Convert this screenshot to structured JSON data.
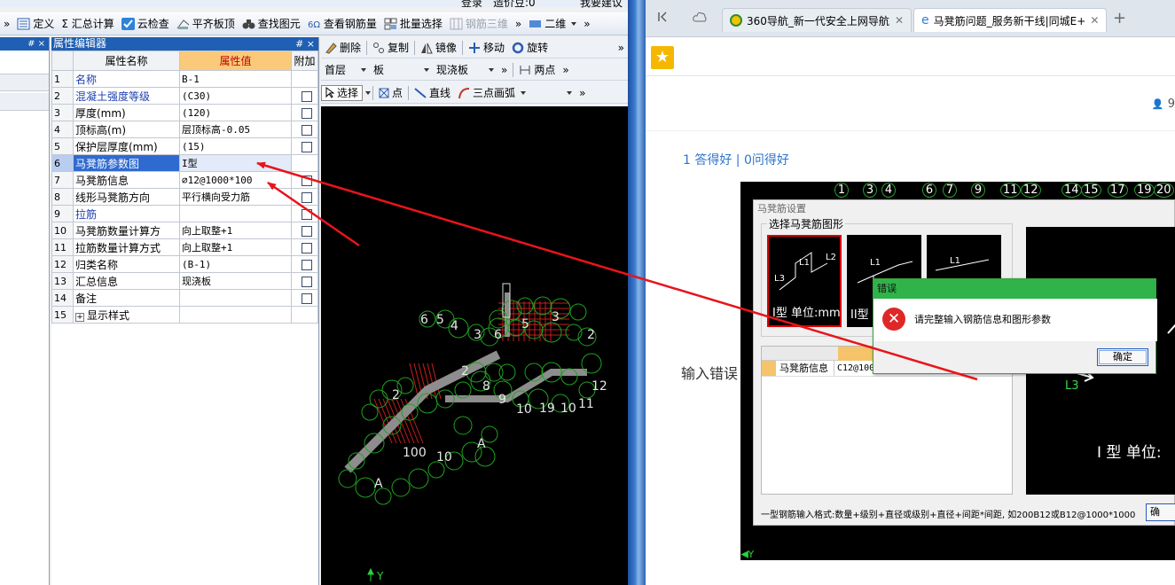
{
  "cad": {
    "top_strip": [
      "登录",
      "造价豆:0",
      "我要建议"
    ],
    "toolbar": [
      {
        "label": "»",
        "icon": ""
      },
      {
        "label": "定义",
        "icon": "define-icon"
      },
      {
        "label": "Σ 汇总计算",
        "icon": ""
      },
      {
        "label": "云检查",
        "icon": "cloud-check-icon"
      },
      {
        "label": "平齐板顶",
        "icon": "align-icon"
      },
      {
        "label": "查找图元",
        "icon": "binoculars-icon"
      },
      {
        "label": "查看钢筋量",
        "icon": "rebar-icon"
      },
      {
        "label": "批量选择",
        "icon": "batch-icon"
      },
      {
        "label": "钢筋三维",
        "icon": "rebar-3d-icon",
        "disabled": true
      },
      {
        "label": "»",
        "icon": ""
      },
      {
        "label": "二维",
        "icon": "2d-icon",
        "dropdown": true
      },
      {
        "label": "»",
        "icon": ""
      }
    ],
    "left_pane_pin": "# ×",
    "property_editor": {
      "title": "属性编辑器",
      "pin": "# ×",
      "headers": {
        "name": "属性名称",
        "value": "属性值",
        "extra": "附加"
      },
      "rows": [
        {
          "n": "1",
          "name": "名称",
          "value": "B-1",
          "blue": true,
          "check": false
        },
        {
          "n": "2",
          "name": "混凝土强度等级",
          "value": "(C30)",
          "blue": true,
          "check": true
        },
        {
          "n": "3",
          "name": "厚度(mm)",
          "value": "(120)",
          "blue": false,
          "check": true
        },
        {
          "n": "4",
          "name": "顶标高(m)",
          "value": "层顶标高-0.05",
          "blue": false,
          "check": true
        },
        {
          "n": "5",
          "name": "保护层厚度(mm)",
          "value": "(15)",
          "blue": false,
          "check": true
        },
        {
          "n": "6",
          "name": "马凳筋参数图",
          "value": "I型",
          "blue": false,
          "check": false,
          "selected": true
        },
        {
          "n": "7",
          "name": "马凳筋信息",
          "value": "⌀12@1000*100",
          "blue": false,
          "check": true
        },
        {
          "n": "8",
          "name": "线形马凳筋方向",
          "value": "平行横向受力筋",
          "blue": false,
          "check": true
        },
        {
          "n": "9",
          "name": "拉筋",
          "value": "",
          "blue": true,
          "check": true
        },
        {
          "n": "10",
          "name": "马凳筋数量计算方",
          "value": "向上取整+1",
          "blue": false,
          "check": true
        },
        {
          "n": "11",
          "name": "拉筋数量计算方式",
          "value": "向上取整+1",
          "blue": false,
          "check": true
        },
        {
          "n": "12",
          "name": "归类名称",
          "value": "(B-1)",
          "blue": false,
          "check": true
        },
        {
          "n": "13",
          "name": "汇总信息",
          "value": "现浇板",
          "blue": false,
          "check": true
        },
        {
          "n": "14",
          "name": "备注",
          "value": "",
          "blue": false,
          "check": true
        },
        {
          "n": "15",
          "name": "显示样式",
          "value": "",
          "blue": false,
          "check": false,
          "expand": true
        }
      ]
    },
    "draw_toolbar": {
      "row1": [
        "删除",
        "复制",
        "镜像",
        "移动",
        "旋转",
        "»"
      ],
      "row2": {
        "floor": "首层",
        "type": "板",
        "sub": "现浇板",
        "more": "»",
        "two_point": "两点",
        "more2": "»"
      },
      "row3": [
        "选择",
        "点",
        "直线",
        "三点画弧",
        "»"
      ]
    },
    "axis_label": "Y"
  },
  "browser": {
    "tabs": [
      {
        "label": "360导航_新一代安全上网导航",
        "active": false
      },
      {
        "label": "马凳筋问题_服务新干线|同城E+",
        "active": true
      }
    ],
    "new_tab": "+",
    "user_count": "9",
    "answer_stats": "1 答得好 | 0问得好",
    "input_error_text": "输入错误",
    "screenshot": {
      "axis_numbers": [
        "1",
        "3",
        "4",
        "6",
        "7",
        "9",
        "11",
        "12",
        "14",
        "15",
        "17",
        "19",
        "20"
      ],
      "dialog_title": "马凳筋设置",
      "group_label": "选择马凳筋图形",
      "thumbs": [
        "I型 单位:mm",
        "II型",
        ""
      ],
      "thumb_labels": [
        "L1",
        "L2",
        "L3",
        "L1",
        "L1"
      ],
      "table_row_label": "马凳筋信息",
      "table_row_value": "C12@1000",
      "preview_label_L3": "L3",
      "preview_big": "I 型  单位:",
      "format_hint": "一型钢筋输入格式:数量+级别+直径或级别+直径+间距*间距, 如200B12或B12@1000*1000",
      "ok_partial": "确",
      "axis_y": "Y"
    },
    "error_dialog": {
      "title": "错误",
      "message": "请完整输入钢筋信息和图形参数",
      "ok": "确定"
    }
  },
  "colors": {
    "arrow": "#e8141b",
    "title_blue": "#1f5fb4",
    "header_orange": "#fbc97a",
    "error_green": "#2fb34a"
  }
}
